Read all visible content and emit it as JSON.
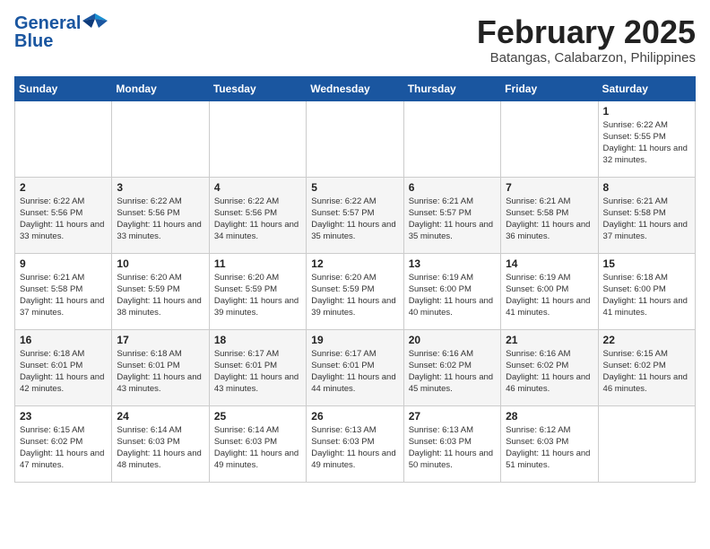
{
  "header": {
    "logo_general": "General",
    "logo_blue": "Blue",
    "month": "February 2025",
    "location": "Batangas, Calabarzon, Philippines"
  },
  "weekdays": [
    "Sunday",
    "Monday",
    "Tuesday",
    "Wednesday",
    "Thursday",
    "Friday",
    "Saturday"
  ],
  "weeks": [
    [
      {
        "day": "",
        "info": ""
      },
      {
        "day": "",
        "info": ""
      },
      {
        "day": "",
        "info": ""
      },
      {
        "day": "",
        "info": ""
      },
      {
        "day": "",
        "info": ""
      },
      {
        "day": "",
        "info": ""
      },
      {
        "day": "1",
        "info": "Sunrise: 6:22 AM\nSunset: 5:55 PM\nDaylight: 11 hours and 32 minutes."
      }
    ],
    [
      {
        "day": "2",
        "info": "Sunrise: 6:22 AM\nSunset: 5:56 PM\nDaylight: 11 hours and 33 minutes."
      },
      {
        "day": "3",
        "info": "Sunrise: 6:22 AM\nSunset: 5:56 PM\nDaylight: 11 hours and 33 minutes."
      },
      {
        "day": "4",
        "info": "Sunrise: 6:22 AM\nSunset: 5:56 PM\nDaylight: 11 hours and 34 minutes."
      },
      {
        "day": "5",
        "info": "Sunrise: 6:22 AM\nSunset: 5:57 PM\nDaylight: 11 hours and 35 minutes."
      },
      {
        "day": "6",
        "info": "Sunrise: 6:21 AM\nSunset: 5:57 PM\nDaylight: 11 hours and 35 minutes."
      },
      {
        "day": "7",
        "info": "Sunrise: 6:21 AM\nSunset: 5:58 PM\nDaylight: 11 hours and 36 minutes."
      },
      {
        "day": "8",
        "info": "Sunrise: 6:21 AM\nSunset: 5:58 PM\nDaylight: 11 hours and 37 minutes."
      }
    ],
    [
      {
        "day": "9",
        "info": "Sunrise: 6:21 AM\nSunset: 5:58 PM\nDaylight: 11 hours and 37 minutes."
      },
      {
        "day": "10",
        "info": "Sunrise: 6:20 AM\nSunset: 5:59 PM\nDaylight: 11 hours and 38 minutes."
      },
      {
        "day": "11",
        "info": "Sunrise: 6:20 AM\nSunset: 5:59 PM\nDaylight: 11 hours and 39 minutes."
      },
      {
        "day": "12",
        "info": "Sunrise: 6:20 AM\nSunset: 5:59 PM\nDaylight: 11 hours and 39 minutes."
      },
      {
        "day": "13",
        "info": "Sunrise: 6:19 AM\nSunset: 6:00 PM\nDaylight: 11 hours and 40 minutes."
      },
      {
        "day": "14",
        "info": "Sunrise: 6:19 AM\nSunset: 6:00 PM\nDaylight: 11 hours and 41 minutes."
      },
      {
        "day": "15",
        "info": "Sunrise: 6:18 AM\nSunset: 6:00 PM\nDaylight: 11 hours and 41 minutes."
      }
    ],
    [
      {
        "day": "16",
        "info": "Sunrise: 6:18 AM\nSunset: 6:01 PM\nDaylight: 11 hours and 42 minutes."
      },
      {
        "day": "17",
        "info": "Sunrise: 6:18 AM\nSunset: 6:01 PM\nDaylight: 11 hours and 43 minutes."
      },
      {
        "day": "18",
        "info": "Sunrise: 6:17 AM\nSunset: 6:01 PM\nDaylight: 11 hours and 43 minutes."
      },
      {
        "day": "19",
        "info": "Sunrise: 6:17 AM\nSunset: 6:01 PM\nDaylight: 11 hours and 44 minutes."
      },
      {
        "day": "20",
        "info": "Sunrise: 6:16 AM\nSunset: 6:02 PM\nDaylight: 11 hours and 45 minutes."
      },
      {
        "day": "21",
        "info": "Sunrise: 6:16 AM\nSunset: 6:02 PM\nDaylight: 11 hours and 46 minutes."
      },
      {
        "day": "22",
        "info": "Sunrise: 6:15 AM\nSunset: 6:02 PM\nDaylight: 11 hours and 46 minutes."
      }
    ],
    [
      {
        "day": "23",
        "info": "Sunrise: 6:15 AM\nSunset: 6:02 PM\nDaylight: 11 hours and 47 minutes."
      },
      {
        "day": "24",
        "info": "Sunrise: 6:14 AM\nSunset: 6:03 PM\nDaylight: 11 hours and 48 minutes."
      },
      {
        "day": "25",
        "info": "Sunrise: 6:14 AM\nSunset: 6:03 PM\nDaylight: 11 hours and 49 minutes."
      },
      {
        "day": "26",
        "info": "Sunrise: 6:13 AM\nSunset: 6:03 PM\nDaylight: 11 hours and 49 minutes."
      },
      {
        "day": "27",
        "info": "Sunrise: 6:13 AM\nSunset: 6:03 PM\nDaylight: 11 hours and 50 minutes."
      },
      {
        "day": "28",
        "info": "Sunrise: 6:12 AM\nSunset: 6:03 PM\nDaylight: 11 hours and 51 minutes."
      },
      {
        "day": "",
        "info": ""
      }
    ]
  ]
}
